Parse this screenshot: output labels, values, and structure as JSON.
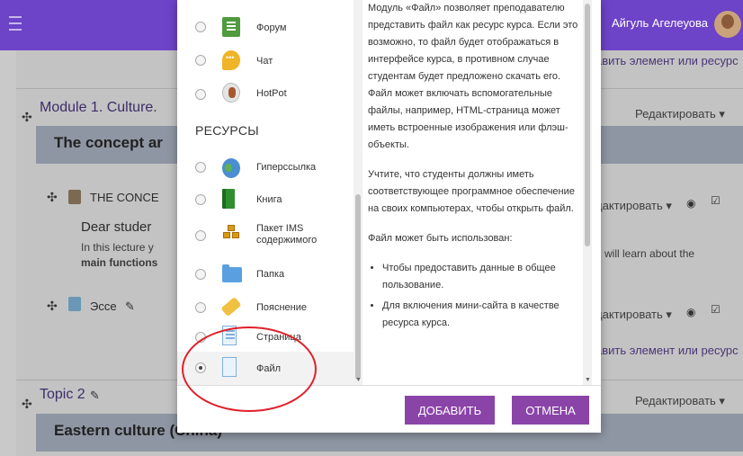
{
  "header": {
    "user_name": "Айгуль Агелеуова",
    "user_chevron": "›"
  },
  "background": {
    "add_activity_link": "авить элемент или ресурс",
    "section1": {
      "title": "Module 1. Culture.",
      "banner": "The concept ar",
      "edit": "Редактировать ▾"
    },
    "activity1": {
      "title": "THE CONCE",
      "edit": "дактировать ▾",
      "subtitle": "Dear studer",
      "text_left": "In this lecture y",
      "text_right": "u will learn about the",
      "text_bold": "main functions"
    },
    "activity2": {
      "title": "Эссе",
      "edit": "дактировать ▾"
    },
    "add_activity_link2": "авить элемент или ресурс",
    "section2": {
      "title": "Topic 2",
      "banner": "Eastern culture (China)",
      "edit": "Редактировать ▾"
    }
  },
  "chooser": {
    "activities": [
      {
        "label": "Форум",
        "icon": "forum-icon"
      },
      {
        "label": "Чат",
        "icon": "chat-icon"
      },
      {
        "label": "HotPot",
        "icon": "hotpot-icon"
      }
    ],
    "resources_label": "РЕСУРСЫ",
    "resources": [
      {
        "label": "Гиперссылка",
        "icon": "url-icon"
      },
      {
        "label": "Книга",
        "icon": "book-icon"
      },
      {
        "label": "Пакет IMS содержимого",
        "icon": "ims-package-icon"
      },
      {
        "label": "Папка",
        "icon": "folder-icon"
      },
      {
        "label": "Пояснение",
        "icon": "label-icon"
      },
      {
        "label": "Страница",
        "icon": "page-icon"
      },
      {
        "label": "Файл",
        "icon": "file-icon",
        "selected": true
      }
    ]
  },
  "description": {
    "p1": "Модуль «Файл» позволяет преподавателю представить файл как ресурс курса. Если это возможно, то файл будет отображаться в интерфейсе курса, в противном случае студентам будет предложено скачать его. Файл может включать вспомогательные файлы, например, HTML-страница может иметь встроенные изображения или флэш-объекты.",
    "p2": "Учтите, что студенты должны иметь соответствующее программное обеспечение на своих компьютерах, чтобы открыть файл.",
    "p3": "Файл может быть использован:",
    "bullets": [
      "Чтобы предоставить данные в общее пользование.",
      "Для включения мини-сайта в качестве ресурса курса."
    ]
  },
  "buttons": {
    "add": "ДОБАВИТЬ",
    "cancel": "ОТМЕНА"
  },
  "colors": {
    "topbar": "#6d43c8",
    "button": "#8a44a8",
    "annotation": "#e0202a"
  }
}
